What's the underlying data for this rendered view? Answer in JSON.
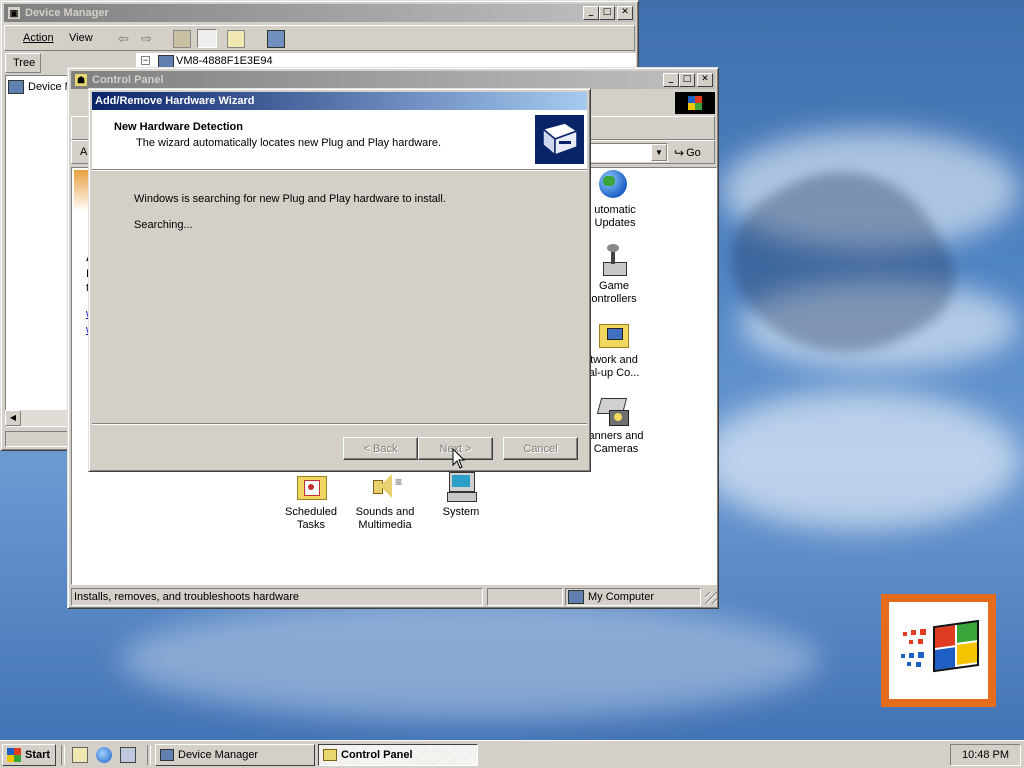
{
  "device_manager": {
    "title": "Device Manager",
    "menu": [
      "Action",
      "View"
    ],
    "tab": "Tree",
    "tree_root": "VM8-4888F1E3E94",
    "tree_item": "Device M"
  },
  "control_panel": {
    "title": "Control Panel",
    "go_label": "Go",
    "status_left": "Installs, removes, and troubleshoots hardware",
    "status_right": "My Computer",
    "icons": [
      {
        "label": "Automatic Updates",
        "visible": "utomatic Updates"
      },
      {
        "label": "Game Controllers",
        "visible": "Game ontrollers"
      },
      {
        "label": "Network and Dial-up Connections",
        "visible": "twork and al-up Co..."
      },
      {
        "label": "Scanners and Cameras",
        "visible": "anners and Cameras"
      },
      {
        "label": "Scheduled Tasks",
        "visible": "Scheduled Tasks"
      },
      {
        "label": "Sounds and Multimedia",
        "visible": "Sounds and Multimedia"
      },
      {
        "label": "System",
        "visible": "System"
      }
    ]
  },
  "wizard": {
    "title": "Add/Remove Hardware Wizard",
    "header_title": "New Hardware Detection",
    "header_subtitle": "The wizard automatically locates new Plug and Play hardware.",
    "body_line1": "Windows is searching for new Plug and Play hardware to install.",
    "body_line2": "Searching...",
    "back_label": "< Back",
    "next_label": "Next >",
    "cancel_label": "Cancel"
  },
  "taskbar": {
    "start_label": "Start",
    "tasks": [
      "Device Manager",
      "Control Panel"
    ],
    "clock": "10:48 PM"
  },
  "colors": {
    "active_title": "#0a246a",
    "inactive_title": "#808080",
    "face": "#d4d0c8",
    "desktop": "#4f84c4"
  }
}
